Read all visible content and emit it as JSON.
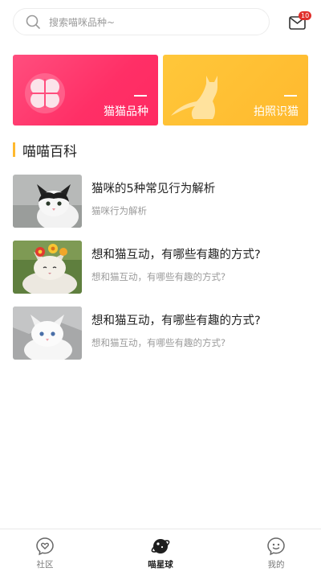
{
  "search": {
    "placeholder": "搜索喵咪品种~"
  },
  "messages": {
    "badge_count": "10"
  },
  "cards": [
    {
      "label": "猫猫品种",
      "color": "#ff3569"
    },
    {
      "label": "拍照识猫",
      "color": "#ffbd33"
    }
  ],
  "section": {
    "title": "喵喵百科",
    "accent": "#ffb92e"
  },
  "articles": [
    {
      "title": "猫咪的5种常见行为解析",
      "subtitle": "猫咪行为解析"
    },
    {
      "title": "想和猫互动，有哪些有趣的方式?",
      "subtitle": "想和猫互动，有哪些有趣的方式?"
    },
    {
      "title": "想和猫互动，有哪些有趣的方式?",
      "subtitle": "想和猫互动，有哪些有趣的方式?"
    }
  ],
  "bottom_nav": [
    {
      "label": "社区",
      "icon": "heart-chat-icon",
      "active": false
    },
    {
      "label": "喵星球",
      "icon": "planet-icon",
      "active": true
    },
    {
      "label": "我的",
      "icon": "smile-face-icon",
      "active": false
    }
  ]
}
